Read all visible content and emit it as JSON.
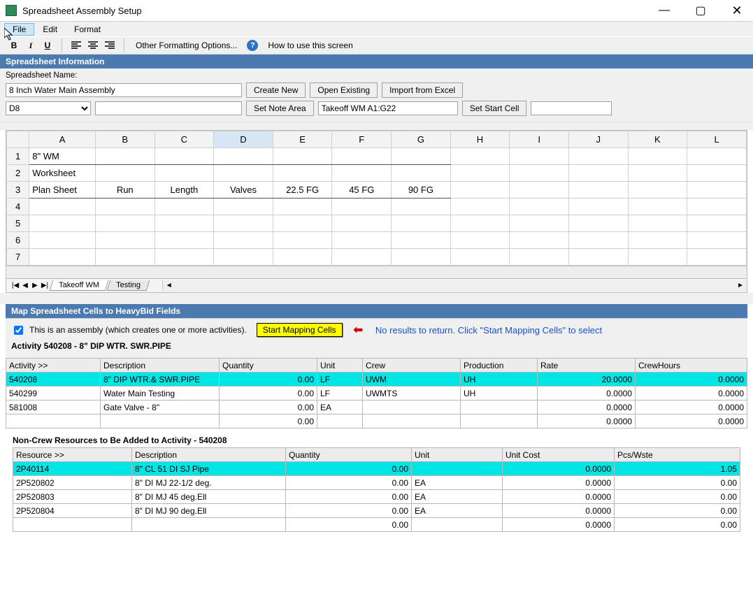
{
  "window": {
    "title": "Spreadsheet Assembly Setup"
  },
  "menu": {
    "file": "File",
    "edit": "Edit",
    "format": "Format"
  },
  "toolbar": {
    "other": "Other Formatting Options...",
    "help": "How to use this screen"
  },
  "section_info": "Spreadsheet Information",
  "info": {
    "name_label": "Spreadsheet Name:",
    "name_value": "8 Inch Water Main Assembly",
    "create": "Create New",
    "open": "Open Existing",
    "import": "Import from Excel",
    "cellref": "D8",
    "note_btn": "Set Note Area",
    "range_value": "Takeoff WM A1:G22",
    "start_btn": "Set Start Cell"
  },
  "grid": {
    "cols": [
      "A",
      "B",
      "C",
      "D",
      "E",
      "F",
      "G",
      "H",
      "I",
      "J",
      "K",
      "L"
    ],
    "rows": [
      {
        "r": "1",
        "cells": [
          "8\" WM",
          "",
          "",
          "",
          "",
          "",
          "",
          "",
          "",
          "",
          "",
          ""
        ]
      },
      {
        "r": "2",
        "cells": [
          "Worksheet",
          "",
          "",
          "",
          "",
          "",
          "",
          "",
          "",
          "",
          "",
          ""
        ]
      },
      {
        "r": "3",
        "cells": [
          "Plan Sheet",
          "Run",
          "Length",
          "Valves",
          "22.5 FG",
          "45 FG",
          "90 FG",
          "",
          "",
          "",
          "",
          ""
        ]
      },
      {
        "r": "4",
        "cells": [
          "",
          "",
          "",
          "",
          "",
          "",
          "",
          "",
          "",
          "",
          "",
          ""
        ]
      },
      {
        "r": "5",
        "cells": [
          "",
          "",
          "",
          "",
          "",
          "",
          "",
          "",
          "",
          "",
          "",
          ""
        ]
      },
      {
        "r": "6",
        "cells": [
          "",
          "",
          "",
          "",
          "",
          "",
          "",
          "",
          "",
          "",
          "",
          ""
        ]
      },
      {
        "r": "7",
        "cells": [
          "",
          "",
          "",
          "",
          "",
          "",
          "",
          "",
          "",
          "",
          "",
          ""
        ]
      }
    ],
    "tabs": {
      "t1": "Takeoff WM",
      "t2": "Testing"
    }
  },
  "section_map": "Map Spreadsheet Cells to HeavyBid Fields",
  "map": {
    "assembly_chk": "This is an assembly (which creates one or more activities).",
    "start_mapping": "Start Mapping Cells",
    "noresults": "No results to return. Click \"Start Mapping Cells\" to select",
    "activity_title": "Activity 540208 - 8\"  DIP WTR. SWR.PIPE"
  },
  "act_headers": {
    "activity": "Activity >>",
    "desc": "Description",
    "qty": "Quantity",
    "unit": "Unit",
    "crew": "Crew",
    "prod": "Production",
    "rate": "Rate",
    "ch": "CrewHours"
  },
  "activities": [
    {
      "hl": true,
      "act": "540208",
      "desc": "8\"  DIP WTR.& SWR.PIPE",
      "qty": "0.00",
      "unit": "LF",
      "crew": "UWM",
      "prod": "UH",
      "rate": "20.0000",
      "ch": "0.0000"
    },
    {
      "hl": false,
      "act": "540299",
      "desc": "Water Main Testing",
      "qty": "0.00",
      "unit": "LF",
      "crew": "UWMTS",
      "prod": "UH",
      "rate": "0.0000",
      "ch": "0.0000"
    },
    {
      "hl": false,
      "act": "581008",
      "desc": "Gate Valve - 8\"",
      "qty": "0.00",
      "unit": "EA",
      "crew": "",
      "prod": "",
      "rate": "0.0000",
      "ch": "0.0000"
    },
    {
      "hl": false,
      "act": "",
      "desc": "",
      "qty": "0.00",
      "unit": "",
      "crew": "",
      "prod": "",
      "rate": "0.0000",
      "ch": "0.0000"
    }
  ],
  "res_title": "Non-Crew Resources to Be Added to Activity - 540208",
  "res_headers": {
    "res": "Resource >>",
    "desc": "Description",
    "qty": "Quantity",
    "unit": "Unit",
    "uc": "Unit Cost",
    "pw": "Pcs/Wste"
  },
  "resources": [
    {
      "hl": true,
      "res": "2P40114",
      "desc": "8\" CL 51 DI SJ Pipe",
      "qty": "0.00",
      "unit": "",
      "uc": "0.0000",
      "pw": "1.05"
    },
    {
      "hl": false,
      "res": "2P520802",
      "desc": "8\"  DI MJ 22-1/2 deg.",
      "qty": "0.00",
      "unit": "EA",
      "uc": "0.0000",
      "pw": "0.00"
    },
    {
      "hl": false,
      "res": "2P520803",
      "desc": "8\"  DI MJ 45 deg.Ell",
      "qty": "0.00",
      "unit": "EA",
      "uc": "0.0000",
      "pw": "0.00"
    },
    {
      "hl": false,
      "res": "2P520804",
      "desc": "8\"  DI MJ 90 deg.Ell",
      "qty": "0.00",
      "unit": "EA",
      "uc": "0.0000",
      "pw": "0.00"
    },
    {
      "hl": false,
      "res": "",
      "desc": "",
      "qty": "0.00",
      "unit": "",
      "uc": "0.0000",
      "pw": "0.00"
    }
  ]
}
